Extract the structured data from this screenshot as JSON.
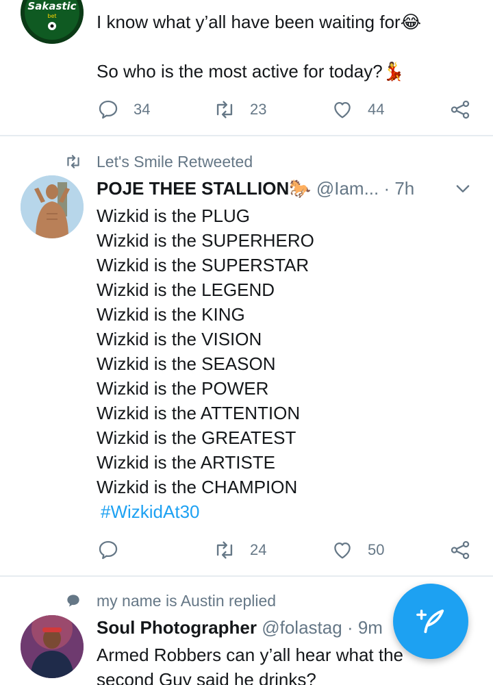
{
  "colors": {
    "accent": "#1da1f2",
    "muted": "#657786",
    "text": "#14171a",
    "divider": "#e6ecf0"
  },
  "tweet1": {
    "avatar_brand_text": "Sakastic",
    "avatar_sub_text": "bet",
    "lines": [
      "I know what y’all have been waiting for😂",
      "",
      "So who is the most active for today?💃"
    ],
    "reply_count": "34",
    "retweet_count": "23",
    "like_count": "44"
  },
  "tweet2": {
    "context_label": "Let's Smile Retweeted",
    "display_name": "POJE THEE STALLION🐎",
    "handle": "@Iam...",
    "time": "· 7h",
    "lines": [
      "Wizkid is the PLUG",
      "Wizkid is the SUPERHERO",
      "Wizkid is the SUPERSTAR",
      "Wizkid is the LEGEND",
      "Wizkid is the KING",
      "Wizkid is the VISION",
      "Wizkid is the SEASON",
      "Wizkid is the POWER",
      "Wizkid is the ATTENTION",
      "Wizkid is the GREATEST",
      "Wizkid is the ARTISTE",
      "Wizkid is the CHAMPION"
    ],
    "hashtag": "#WizkidAt30",
    "reply_count": "",
    "retweet_count": "24",
    "like_count": "50"
  },
  "tweet3": {
    "context_label": "my name is Austin replied",
    "display_name": "Soul Photographer",
    "handle": "@folastag",
    "time": "· 9m",
    "lines": [
      "Armed  Robbers can y’all hear what the",
      "second Guy said he drinks?"
    ]
  },
  "icons": {
    "reply": "reply-icon",
    "retweet": "retweet-icon",
    "like": "heart-icon",
    "share": "share-icon",
    "compose": "compose-tweet-icon"
  }
}
